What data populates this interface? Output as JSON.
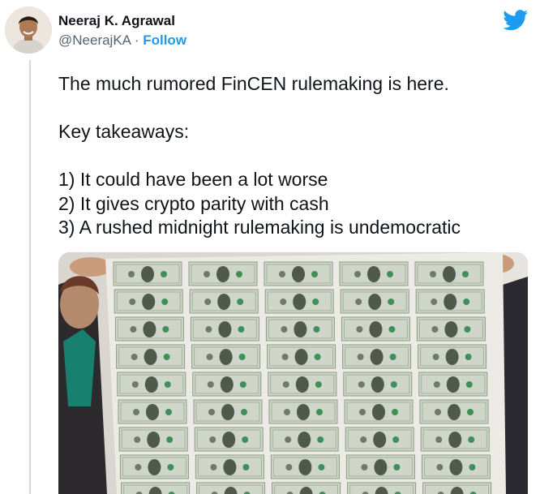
{
  "author": {
    "name": "Neeraj K. Agrawal",
    "handle": "@NeerajKA",
    "separator": "·",
    "follow_label": "Follow"
  },
  "tweet": {
    "line1": "The much rumored FinCEN rulemaking is here.",
    "line2": "Key takeaways:",
    "line3": "1) It could have been a lot worse",
    "line4": "2) It gives crypto parity with cash",
    "line5": "3) A rushed midnight rulemaking is undemocratic"
  },
  "colors": {
    "link": "#1d9bf0",
    "text": "#0f1419",
    "muted": "#536471",
    "money_green": "#9fb498"
  },
  "icons": {
    "logo": "twitter-bird-icon"
  }
}
